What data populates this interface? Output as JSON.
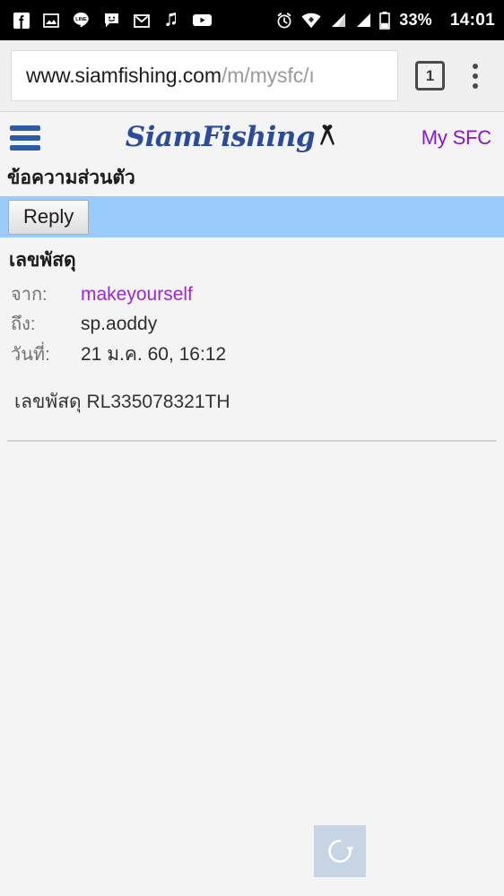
{
  "status_bar": {
    "notification_icons": [
      "facebook-icon",
      "photo-icon",
      "line-icon",
      "messaging-icon",
      "gmail-icon",
      "music-note-icon",
      "youtube-icon"
    ],
    "system_icons": [
      "alarm-icon",
      "wifi-icon",
      "signal-sim1-icon",
      "signal-sim2-icon",
      "battery-icon"
    ],
    "battery_percent": "33%",
    "clock": "14:01"
  },
  "browser": {
    "url_host": "www.siamfishing.com",
    "url_path": "/m/mysfc/ı",
    "url_full": "www.siamfishing.com/m/mysfc/",
    "tab_count": "1",
    "menu_icon": "overflow-menu-icon",
    "tab_icon": "tab-counter-icon"
  },
  "site_header": {
    "menu_icon": "hamburger-menu-icon",
    "logo_text": "SiamFishing",
    "logo_ribbon_icon": "mourning-ribbon-icon",
    "my_sfc_label": "My SFC"
  },
  "page": {
    "title": "ข้อความส่วนตัว"
  },
  "action_bar": {
    "reply_label": "Reply"
  },
  "message": {
    "subject": "เลขพัสดุ",
    "from_label": "จาก:",
    "from_value": "makeyourself",
    "to_label": "ถึง:",
    "to_value": "sp.aoddy",
    "date_label": "วันที่:",
    "date_value": "21 ม.ค. 60, 16:12",
    "body": "เลขพัสดุ RL335078321TH"
  },
  "footer": {
    "loading_icon": "refresh-spinner-icon"
  },
  "colors": {
    "accent_blue": "#2d5ca6",
    "action_bar_blue": "#99ccfc",
    "link_purple": "#9c27d0",
    "my_sfc_purple": "#8a16c4",
    "page_background": "#f4f4f4",
    "status_bar_background": "#000000"
  }
}
